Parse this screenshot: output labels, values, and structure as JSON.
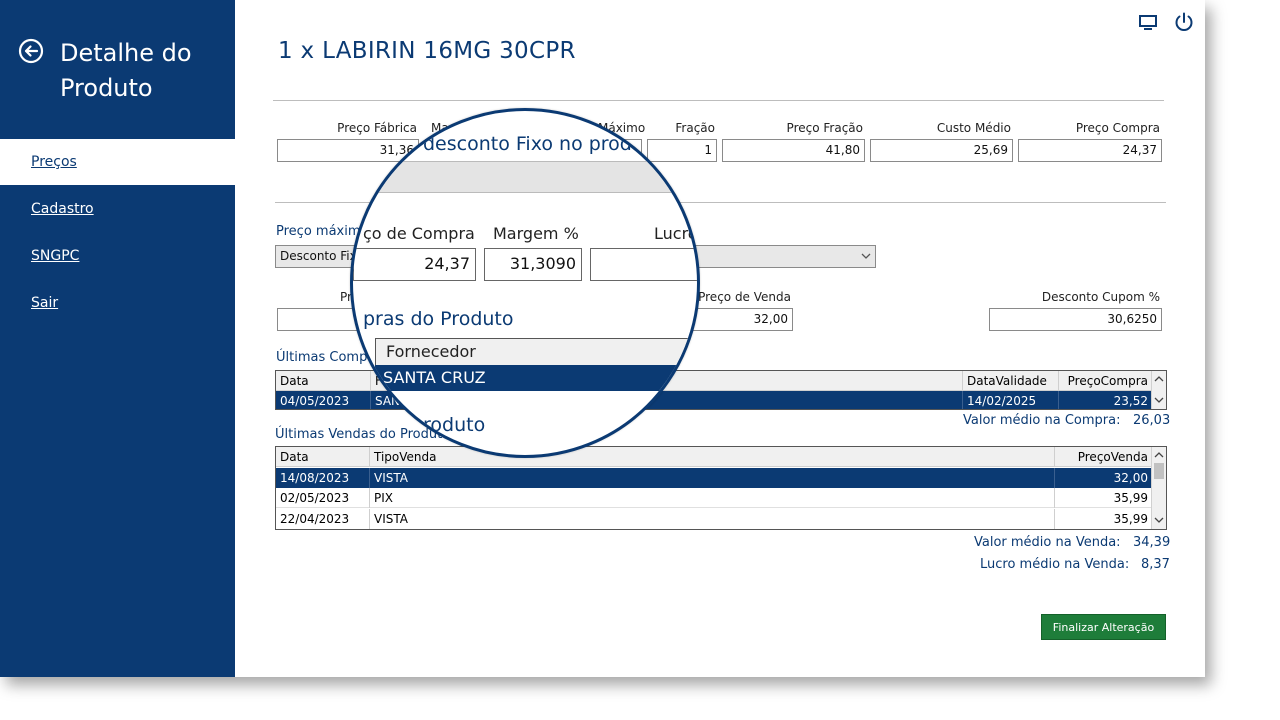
{
  "sidebar": {
    "title": "Detalhe do Produto",
    "items": [
      {
        "label": "Preços",
        "active": true
      },
      {
        "label": "Cadastro",
        "active": false
      },
      {
        "label": "SNGPC",
        "active": false
      },
      {
        "label": "Sair",
        "active": false
      }
    ]
  },
  "header": {
    "title": "1 x LABIRIN 16MG 30CPR"
  },
  "prices": {
    "preco_fabrica_label": "Preço Fábrica",
    "preco_fabrica_value": "31,36",
    "max_label_partial": "Ma",
    "maximo_label": "Máximo",
    "fracao_label": "Fração",
    "fracao_value": "1",
    "preco_fracao_label": "Preço Fração",
    "preco_fracao_value": "41,80",
    "custo_medio_label": "Custo Médio",
    "custo_medio_value": "25,69",
    "preco_compra_label": "Preço Compra",
    "preco_compra_value": "24,37"
  },
  "margin": {
    "preco_maximo_label": "Preço máxim",
    "desconto_select_value": "Desconto Fixo",
    "pr_label": "Pr",
    "preco_venda_label": "Preço de Venda",
    "preco_venda_value": "32,00",
    "desconto_cupom_label": "Desconto Cupom %",
    "desconto_cupom_value": "30,6250"
  },
  "compras": {
    "title": "Últimas Compr",
    "columns": [
      "Data",
      "F",
      "DataValidade",
      "PreçoCompra"
    ],
    "rows": [
      {
        "data": "04/05/2023",
        "fornecedor": "SAN",
        "validade": "14/02/2025",
        "preco": "23,52"
      }
    ],
    "avg_label": "Valor médio na Compra:",
    "avg_value": "26,03"
  },
  "vendas": {
    "title": "Últimas Vendas do Produto",
    "columns": [
      "Data",
      "TipoVenda",
      "PreçoVenda"
    ],
    "rows": [
      {
        "data": "14/08/2023",
        "tipo": "VISTA",
        "preco": "32,00"
      },
      {
        "data": "02/05/2023",
        "tipo": "PIX",
        "preco": "35,99"
      },
      {
        "data": "22/04/2023",
        "tipo": "VISTA",
        "preco": "35,99"
      }
    ],
    "avg_label": "Valor médio na Venda:",
    "avg_value": "34,39",
    "lucro_label": "Lucro médio na Venda:",
    "lucro_value": "8,37"
  },
  "magnifier": {
    "desconto_fixo_text": "desconto Fixo no produ",
    "compra_label": "ço de Compra",
    "margem_label": "Margem %",
    "lucro_label": "Lucro",
    "compra_value": "24,37",
    "margem_value": "31,3090",
    "compras_title": "pras do Produto",
    "fornecedor_header": "Fornecedor",
    "fornecedor_value": "SANTA CRUZ",
    "produto_text": "roduto"
  },
  "actions": {
    "finish_label": "Finalizar Alteração"
  },
  "colors": {
    "brand": "#0b3a73",
    "finish": "#1e7d3a"
  }
}
